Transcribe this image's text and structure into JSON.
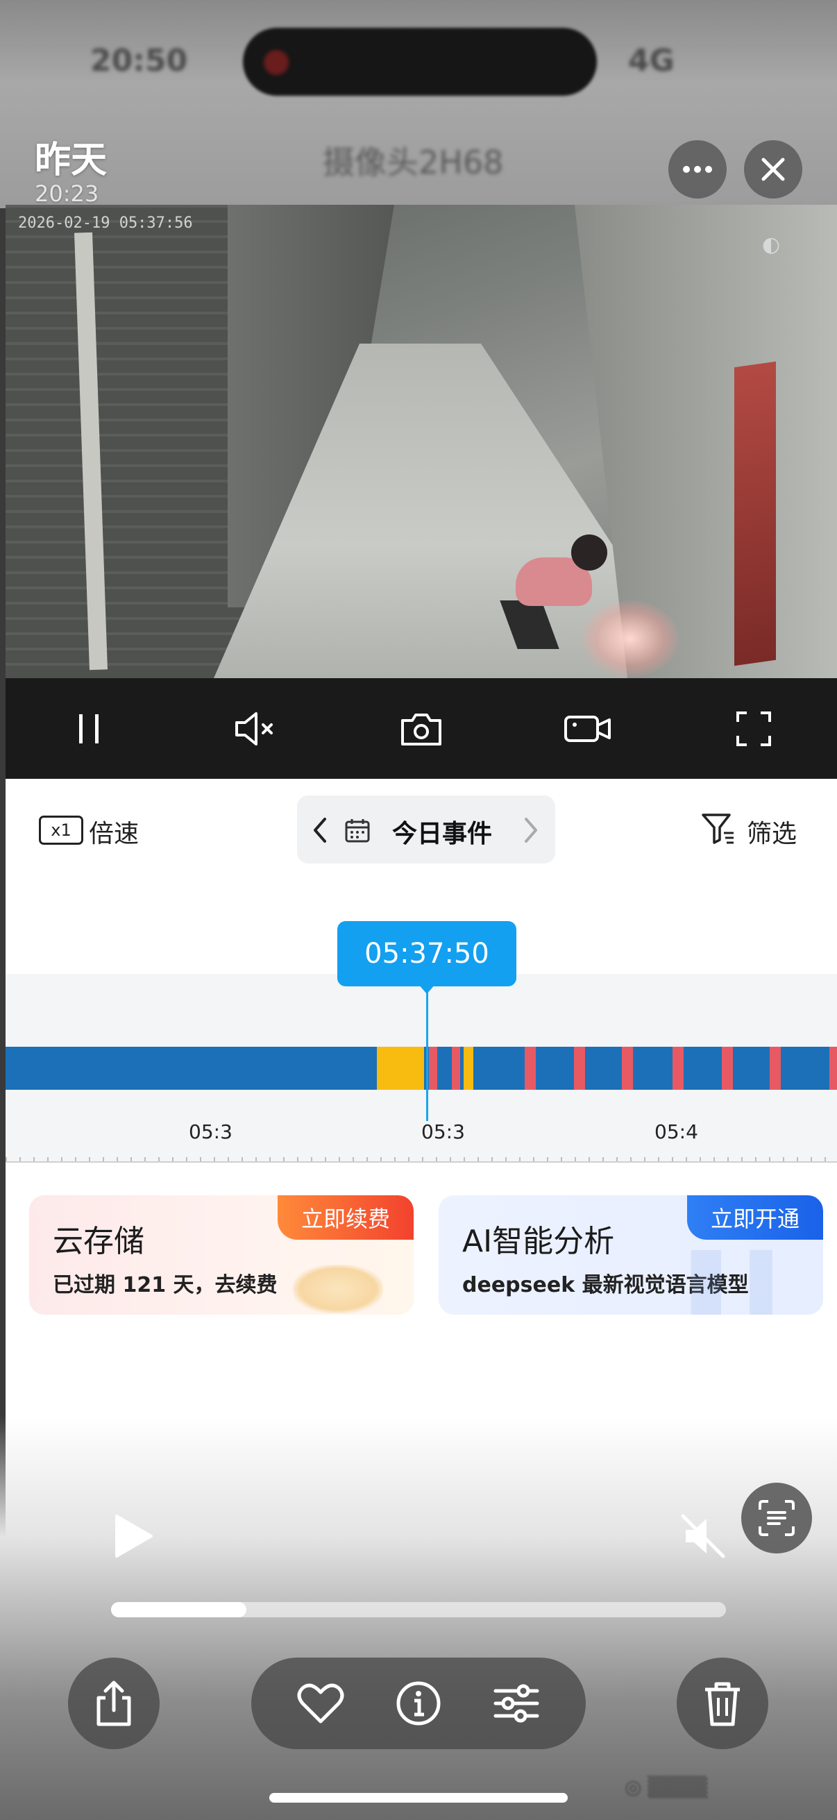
{
  "status_bar": {
    "time_blurred": "20:50",
    "status_blurred": "4G"
  },
  "viewer": {
    "title": "昨天",
    "time": "20:23",
    "blurred_title": "摄像头2H68"
  },
  "video": {
    "osd_timestamp": "2026-02-19 05:37:56"
  },
  "player_controls": {
    "icons": [
      "pause-icon",
      "mute-icon",
      "snapshot-icon",
      "record-icon",
      "fullscreen-icon"
    ]
  },
  "toolbar": {
    "speed_badge": "x1",
    "speed_label": "倍速",
    "events_label": "今日事件",
    "filter_label": "筛选"
  },
  "timeline": {
    "current_time": "05:37:50",
    "tick_labels": [
      "05:3",
      "05:3",
      "05:4"
    ],
    "colors": {
      "track": "#1c70b7",
      "highlight_yellow": "#f8bb10",
      "alert_red": "#e75a63",
      "cursor": "#13a0f0"
    }
  },
  "promos": {
    "cloud": {
      "title": "云存储",
      "subtitle": "已过期 121 天，去续费",
      "tag": "立即续费"
    },
    "ai": {
      "title": "AI智能分析",
      "subtitle": "deepseek 最新视觉语言模型",
      "tag": "立即开通"
    }
  },
  "media_overlay": {
    "progress": 0.22
  }
}
